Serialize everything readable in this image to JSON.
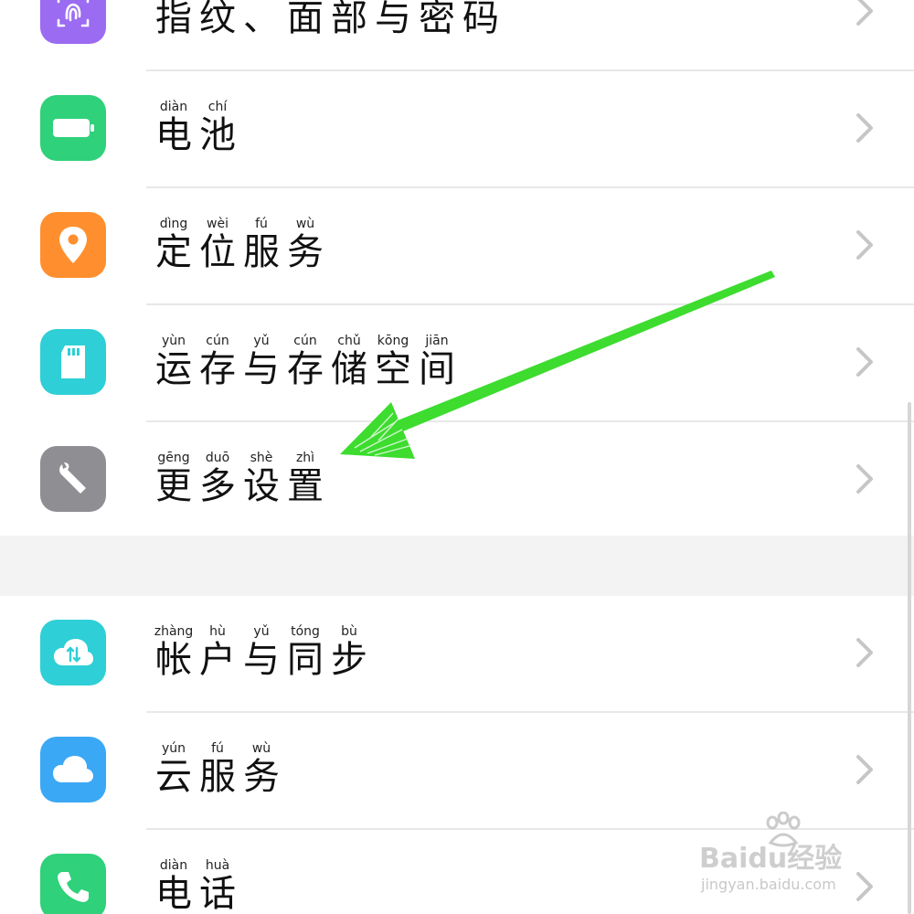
{
  "settings_group_1": [
    {
      "id": "fingerprint",
      "icon": "fingerprint-icon",
      "color": "#9b6bf2",
      "label": [
        {
          "hz": "指",
          "py": ""
        },
        {
          "hz": "纹",
          "py": ""
        },
        {
          "hz": "、",
          "py": ""
        },
        {
          "hz": "面",
          "py": ""
        },
        {
          "hz": "部",
          "py": ""
        },
        {
          "hz": "与",
          "py": ""
        },
        {
          "hz": "密",
          "py": ""
        },
        {
          "hz": "码",
          "py": ""
        }
      ]
    },
    {
      "id": "battery",
      "icon": "battery-icon",
      "color": "#2fd17a",
      "label": [
        {
          "hz": "电",
          "py": "diàn"
        },
        {
          "hz": "池",
          "py": "chí"
        }
      ]
    },
    {
      "id": "location",
      "icon": "location-pin-icon",
      "color": "#ff8f2e",
      "label": [
        {
          "hz": "定",
          "py": "dìng"
        },
        {
          "hz": "位",
          "py": "wèi"
        },
        {
          "hz": "服",
          "py": "fú"
        },
        {
          "hz": "务",
          "py": "wù"
        }
      ]
    },
    {
      "id": "storage",
      "icon": "sd-card-icon",
      "color": "#2ecfd6",
      "label": [
        {
          "hz": "运",
          "py": "yùn"
        },
        {
          "hz": "存",
          "py": "cún"
        },
        {
          "hz": "与",
          "py": "yǔ"
        },
        {
          "hz": "存",
          "py": "cún"
        },
        {
          "hz": "储",
          "py": "chǔ"
        },
        {
          "hz": "空",
          "py": "kōng"
        },
        {
          "hz": "间",
          "py": "jiān"
        }
      ]
    },
    {
      "id": "more",
      "icon": "wrench-icon",
      "color": "#8e8e93",
      "label": [
        {
          "hz": "更",
          "py": "gēng"
        },
        {
          "hz": "多",
          "py": "duō"
        },
        {
          "hz": "设",
          "py": "shè"
        },
        {
          "hz": "置",
          "py": "zhì"
        }
      ]
    }
  ],
  "settings_group_2": [
    {
      "id": "account",
      "icon": "cloud-sync-icon",
      "color": "#2ecfd6",
      "label": [
        {
          "hz": "帐",
          "py": "zhàng"
        },
        {
          "hz": "户",
          "py": "hù"
        },
        {
          "hz": "与",
          "py": "yǔ"
        },
        {
          "hz": "同",
          "py": "tóng"
        },
        {
          "hz": "步",
          "py": "bù"
        }
      ]
    },
    {
      "id": "cloud",
      "icon": "cloud-icon",
      "color": "#3aa8f5",
      "label": [
        {
          "hz": "云",
          "py": "yún"
        },
        {
          "hz": "服",
          "py": "fú"
        },
        {
          "hz": "务",
          "py": "wù"
        }
      ]
    },
    {
      "id": "phone",
      "icon": "phone-icon",
      "color": "#2fd17a",
      "label": [
        {
          "hz": "电",
          "py": "diàn"
        },
        {
          "hz": "话",
          "py": "huà"
        }
      ]
    }
  ],
  "annotation": {
    "arrow_color": "#3ddc2f",
    "points_to": "more"
  },
  "watermark": {
    "logo": "Baidu经验",
    "url": "jingyan.baidu.com"
  }
}
